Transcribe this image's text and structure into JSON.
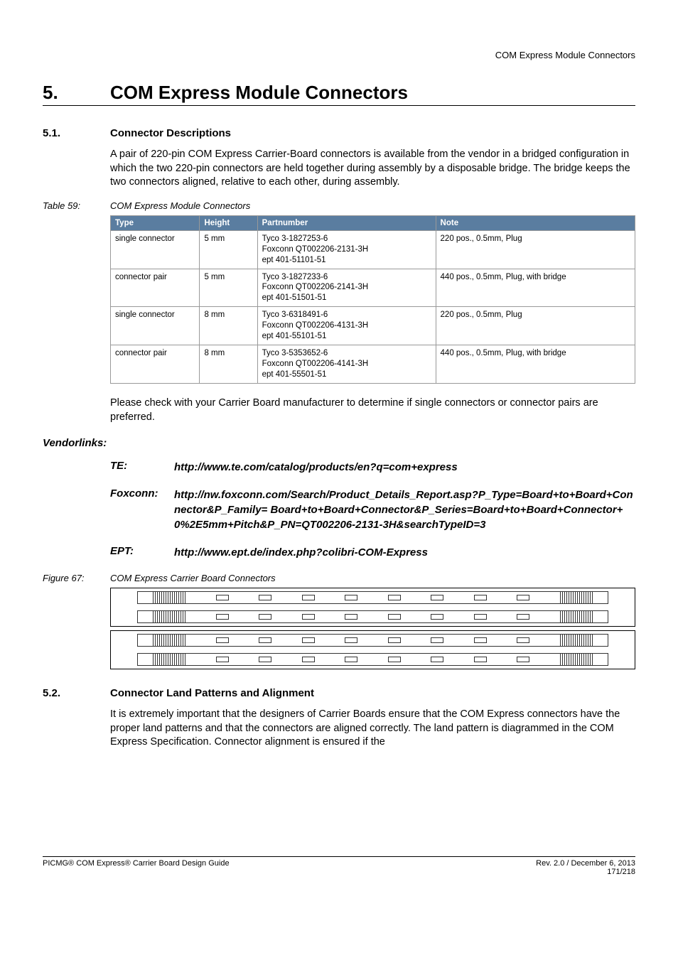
{
  "header": {
    "right": "COM Express Module Connectors"
  },
  "chapter": {
    "number": "5.",
    "title": "COM Express Module Connectors"
  },
  "section51": {
    "number": "5.1.",
    "title": "Connector Descriptions",
    "body": "A pair of 220-pin COM Express Carrier-Board connectors is available from the vendor in a bridged configuration in which the two 220-pin connectors are held together during assembly by a disposable bridge.  The bridge keeps the two connectors aligned, relative to each other, during assembly."
  },
  "table59": {
    "caption_label": "Table 59:",
    "caption_text": "COM Express Module Connectors",
    "headers": {
      "type": "Type",
      "height": "Height",
      "part": "Partnumber",
      "note": "Note"
    },
    "rows": [
      {
        "type": "single connector",
        "height": "5 mm",
        "p1": "Tyco 3-1827253-6",
        "p2": "Foxconn QT002206-2131-3H",
        "p3": "ept 401-51101-51",
        "note": "220 pos., 0.5mm, Plug"
      },
      {
        "type": "connector pair",
        "height": "5 mm",
        "p1": "Tyco 3-1827233-6",
        "p2": "Foxconn QT002206-2141-3H",
        "p3": "ept 401-51501-51",
        "note": "440 pos., 0.5mm, Plug, with bridge"
      },
      {
        "type": "single connector",
        "height": "8 mm",
        "p1": "Tyco 3-6318491-6",
        "p2": "Foxconn QT002206-4131-3H",
        "p3": "ept 401-55101-51",
        "note": "220 pos., 0.5mm, Plug"
      },
      {
        "type": "connector pair",
        "height": "8 mm",
        "p1": "Tyco 3-5353652-6",
        "p2": "Foxconn QT002206-4141-3H",
        "p3": "ept 401-55501-51",
        "note": "440 pos., 0.5mm, Plug, with bridge"
      }
    ],
    "after_text": "Please check with your Carrier Board manufacturer to determine if single connectors or connector pairs are preferred."
  },
  "vendorlinks": {
    "title": "Vendorlinks:",
    "te_label": "TE:",
    "te_url": "http://www.te.com/catalog/products/en?q=com+express",
    "foxconn_label": "Foxconn:",
    "foxconn_url": "http://nw.foxconn.com/Search/Product_Details_Report.asp?P_Type=Board+to+Board+Connector&P_Family= Board+to+Board+Connector&P_Series=Board+to+Board+Connector+0%2E5mm+Pitch&P_PN=QT002206-2131-3H&searchTypeID=3",
    "ept_label": "EPT:",
    "ept_url": "http://www.ept.de/index.php?colibri-COM-Express"
  },
  "figure67": {
    "caption_label": "Figure 67:",
    "caption_text": "COM Express Carrier Board Connectors"
  },
  "section52": {
    "number": "5.2.",
    "title": "Connector Land Patterns and Alignment",
    "body": "It is extremely important that the designers of Carrier Boards ensure that the COM Express connectors have the proper land patterns and that the connectors are aligned correctly.  The land pattern is diagrammed in the COM Express Specification.  Connector alignment is ensured if the"
  },
  "footer": {
    "left": "PICMG® COM Express® Carrier Board Design Guide",
    "right_rev": "Rev. 2.0 / December 6, 2013",
    "right_page": "171/218"
  }
}
